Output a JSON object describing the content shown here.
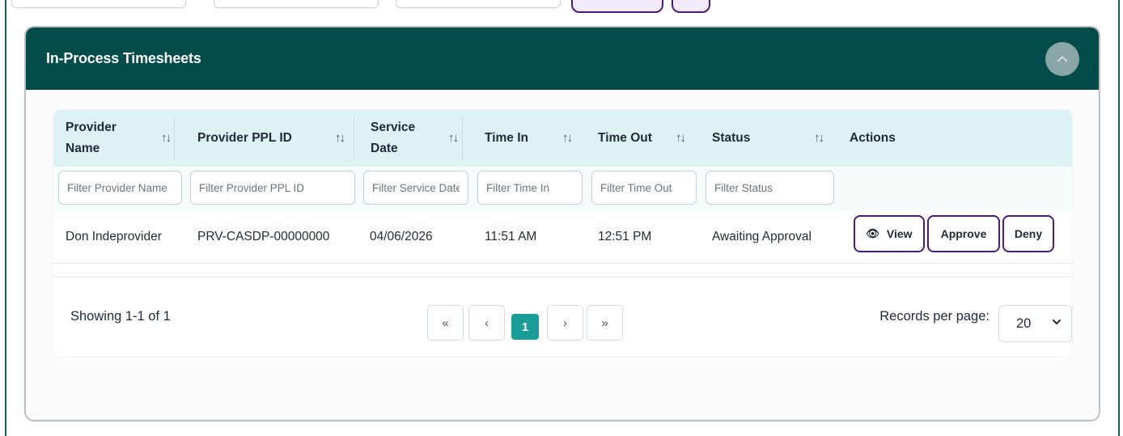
{
  "panel": {
    "title": "In-Process Timesheets",
    "collapse_icon": "chevron-up-icon"
  },
  "table": {
    "columns": [
      {
        "label": "Provider Name",
        "sortable": true
      },
      {
        "label": "Provider PPL ID",
        "sortable": true
      },
      {
        "label": "Service Date",
        "sortable": true
      },
      {
        "label": "Time In",
        "sortable": true
      },
      {
        "label": "Time Out",
        "sortable": true
      },
      {
        "label": "Status",
        "sortable": true
      },
      {
        "label": "Actions",
        "sortable": false
      }
    ],
    "sort_icon": "↑↓",
    "filters": [
      "Filter Provider Name",
      "Filter Provider PPL ID",
      "Filter Service Date",
      "Filter Time In",
      "Filter Time Out",
      "Filter Status"
    ],
    "rows": [
      {
        "provider_name": "Don Indeprovider",
        "provider_ppl_id": "PRV-CASDP-00000000",
        "service_date": "04/06/2026",
        "time_in": "11:51 AM",
        "time_out": "12:51 PM",
        "status": "Awaiting Approval",
        "actions": {
          "view": "View",
          "approve": "Approve",
          "deny": "Deny",
          "view_icon": "eye-icon"
        }
      }
    ]
  },
  "pagination": {
    "showing": "Showing 1-1 of 1",
    "first": "«",
    "prev": "‹",
    "current_page": "1",
    "next": "›",
    "last": "»",
    "records_per_page_label": "Records per page:",
    "records_per_page": "20"
  },
  "colors": {
    "header_bg": "#014b4a",
    "accent_purple": "#4b1c7a",
    "active_page": "#1a9d97",
    "table_header_bg": "#dff2f3"
  }
}
